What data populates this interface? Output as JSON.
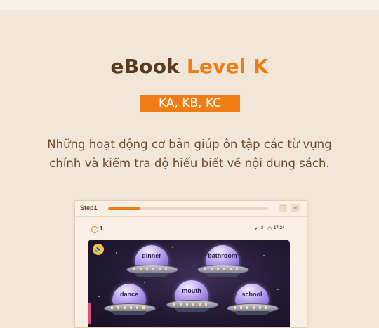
{
  "hero": {
    "title_part1": "eBook",
    "title_part2": "Level K",
    "levels": "KA, KB, KC",
    "description_line1": "Những hoạt động cơ bản giúp ôn tập các từ vựng",
    "description_line2": "chính và kiểm tra độ hiểu biết về nội dung sách."
  },
  "app": {
    "step_label": "Step1",
    "progress": 0.2,
    "question_number": "1.",
    "hearts": "2",
    "timer": "17:24",
    "words": [
      "dinner",
      "bathroom",
      "dance",
      "mouth",
      "school"
    ]
  },
  "colors": {
    "accent": "#f07d14",
    "title_brown": "#5a3a22",
    "background": "#f2e6d8"
  },
  "icons": [
    "sound-icon",
    "heart-icon",
    "timer-icon",
    "fullscreen-icon",
    "settings-icon",
    "question-icon"
  ]
}
